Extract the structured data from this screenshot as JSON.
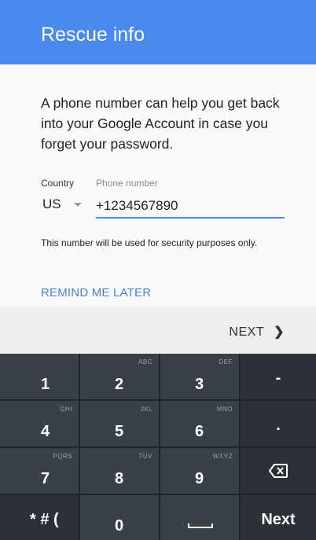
{
  "app_bar": {
    "title": "Rescue info",
    "color": "#4a8aef"
  },
  "content": {
    "intro": "A phone number can help you get back into your Google Account in case you forget your password.",
    "country_label": "Country",
    "country_value": "US",
    "phone_label": "Phone number",
    "phone_value": "+1234567890",
    "hint": "This number will be used for security purposes only.",
    "remind_label": "REMIND ME LATER"
  },
  "nav": {
    "next_label": "NEXT",
    "next_icon": "chevron-right-icon"
  },
  "keyboard": {
    "keys": [
      {
        "main": "1",
        "letters": ""
      },
      {
        "main": "2",
        "letters": "ABC"
      },
      {
        "main": "3",
        "letters": "DEF"
      },
      {
        "main": "-",
        "letters": ""
      },
      {
        "main": "4",
        "letters": "GHI"
      },
      {
        "main": "5",
        "letters": "JKL"
      },
      {
        "main": "6",
        "letters": "MNO"
      },
      {
        "main": ".",
        "letters": ""
      },
      {
        "main": "7",
        "letters": "PQRS"
      },
      {
        "main": "8",
        "letters": "TUV"
      },
      {
        "main": "9",
        "letters": "WXYZ"
      },
      {
        "main": "backspace-icon",
        "letters": ""
      },
      {
        "main": "* # (",
        "letters": ""
      },
      {
        "main": "0",
        "letters": ""
      },
      {
        "main": "space-icon",
        "letters": ""
      },
      {
        "main": "Next",
        "letters": ""
      }
    ]
  }
}
